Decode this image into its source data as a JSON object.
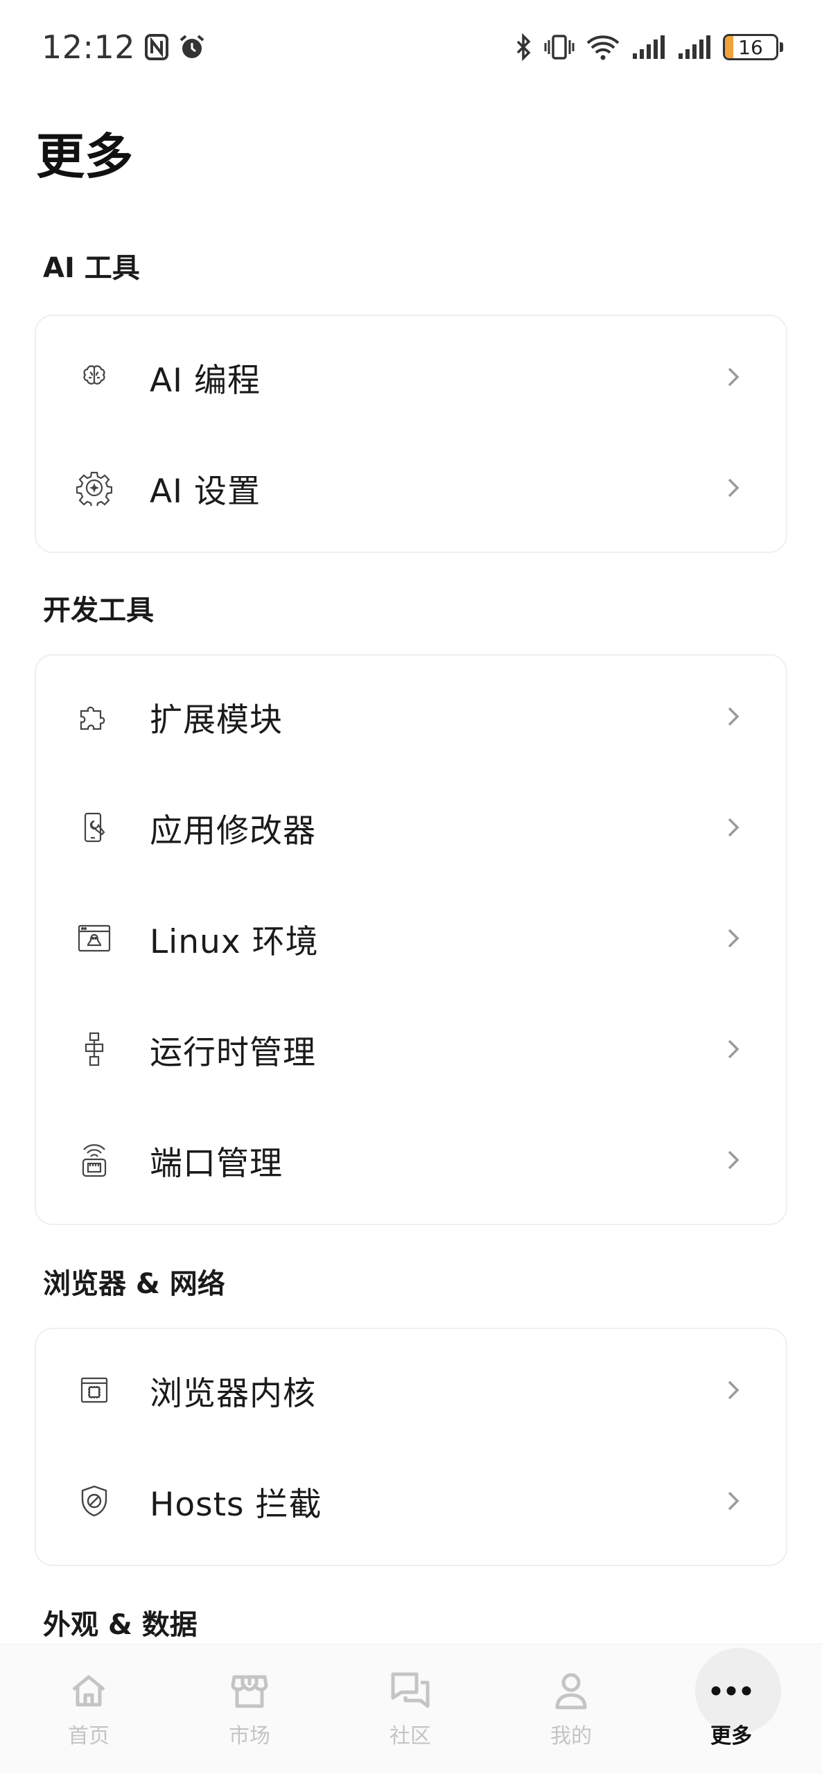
{
  "status_bar": {
    "time": "12:12",
    "battery_level": "16",
    "icons": [
      "nfc-icon",
      "alarm-icon",
      "bluetooth-icon",
      "vibrate-icon",
      "wifi-icon",
      "signal-icon",
      "signal-icon",
      "battery-icon"
    ]
  },
  "page": {
    "title": "更多"
  },
  "sections": [
    {
      "title": "AI 工具",
      "items": [
        {
          "label": "AI 编程",
          "icon": "brain-icon"
        },
        {
          "label": "AI 设置",
          "icon": "ai-gear-icon"
        }
      ]
    },
    {
      "title": "开发工具",
      "items": [
        {
          "label": "扩展模块",
          "icon": "puzzle-icon"
        },
        {
          "label": "应用修改器",
          "icon": "phone-wrench-icon"
        },
        {
          "label": "Linux 环境",
          "icon": "linux-terminal-icon"
        },
        {
          "label": "运行时管理",
          "icon": "runtime-blocks-icon"
        },
        {
          "label": "端口管理",
          "icon": "port-icon"
        }
      ]
    },
    {
      "title": "浏览器 & 网络",
      "items": [
        {
          "label": "浏览器内核",
          "icon": "browser-chip-icon"
        },
        {
          "label": "Hosts 拦截",
          "icon": "shield-block-icon"
        }
      ]
    },
    {
      "title": "外观 & 数据",
      "items": []
    }
  ],
  "bottom_nav": {
    "items": [
      {
        "label": "首页",
        "icon": "home-icon",
        "active": false
      },
      {
        "label": "市场",
        "icon": "store-icon",
        "active": false
      },
      {
        "label": "社区",
        "icon": "chat-icon",
        "active": false
      },
      {
        "label": "我的",
        "icon": "person-icon",
        "active": false
      },
      {
        "label": "更多",
        "icon": "more-dots-icon",
        "active": true
      }
    ]
  },
  "colors": {
    "accent_battery": "#f2a23a",
    "inactive_nav": "#c4c4c4",
    "active_nav": "#111111",
    "card_border": "#efefef"
  }
}
